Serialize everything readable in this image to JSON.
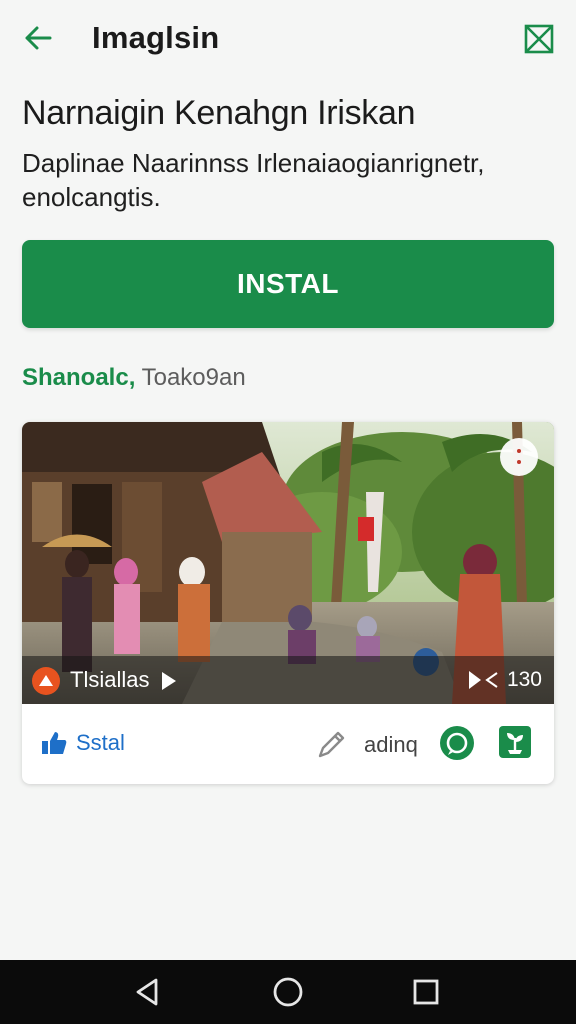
{
  "app": {
    "title": "Imaglsin"
  },
  "content": {
    "headline": "Narnaigin Kenahgn Iriskan",
    "description": "Daplinae Naarinnss Irlenaiaogianrignetr, enolcangtis.",
    "install_label": "INSTAL",
    "section_green": "Shanoalc,",
    "section_rest": " Toako9an"
  },
  "card": {
    "overlay_label": "Tlsiallas",
    "overlay_count": "130",
    "like_label": "Sstal",
    "adding_label": "adinq"
  },
  "icons": {
    "back": "arrow-left-icon",
    "corner": "close-box-icon",
    "menu": "more-options-icon",
    "like": "thumbs-up-icon",
    "edit": "pencil-icon",
    "chat": "chat-icon",
    "plant": "plant-icon",
    "nav_back": "triangle-back-icon",
    "nav_home": "circle-home-icon",
    "nav_recents": "square-recents-icon"
  },
  "colors": {
    "accent": "#1a8c4a",
    "link_blue": "#1e6fc8",
    "background": "#f5f6f5",
    "navbar": "#0b0b0b"
  }
}
